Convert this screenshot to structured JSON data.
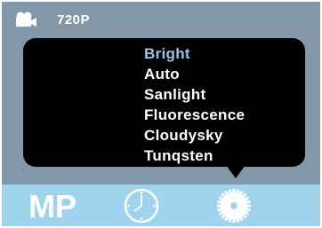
{
  "top_bar": {
    "mode_icon": "video-camera-icon",
    "resolution": "720P"
  },
  "white_balance_menu": {
    "items": [
      {
        "label": "Bright",
        "selected": true
      },
      {
        "label": "Auto",
        "selected": false
      },
      {
        "label": "Sanlight",
        "selected": false
      },
      {
        "label": "Fluorescence",
        "selected": false
      },
      {
        "label": "Cloudysky",
        "selected": false
      },
      {
        "label": "Tunqsten",
        "selected": false
      }
    ]
  },
  "bottom_bar": {
    "mp_label": "MP",
    "icons": [
      "clock-icon",
      "gear-icon"
    ]
  },
  "colors": {
    "screen_background": "#8297a8",
    "bottom_bar": "#9fd3ee",
    "selected_item": "#9bc3ea",
    "popup": "#000000"
  }
}
